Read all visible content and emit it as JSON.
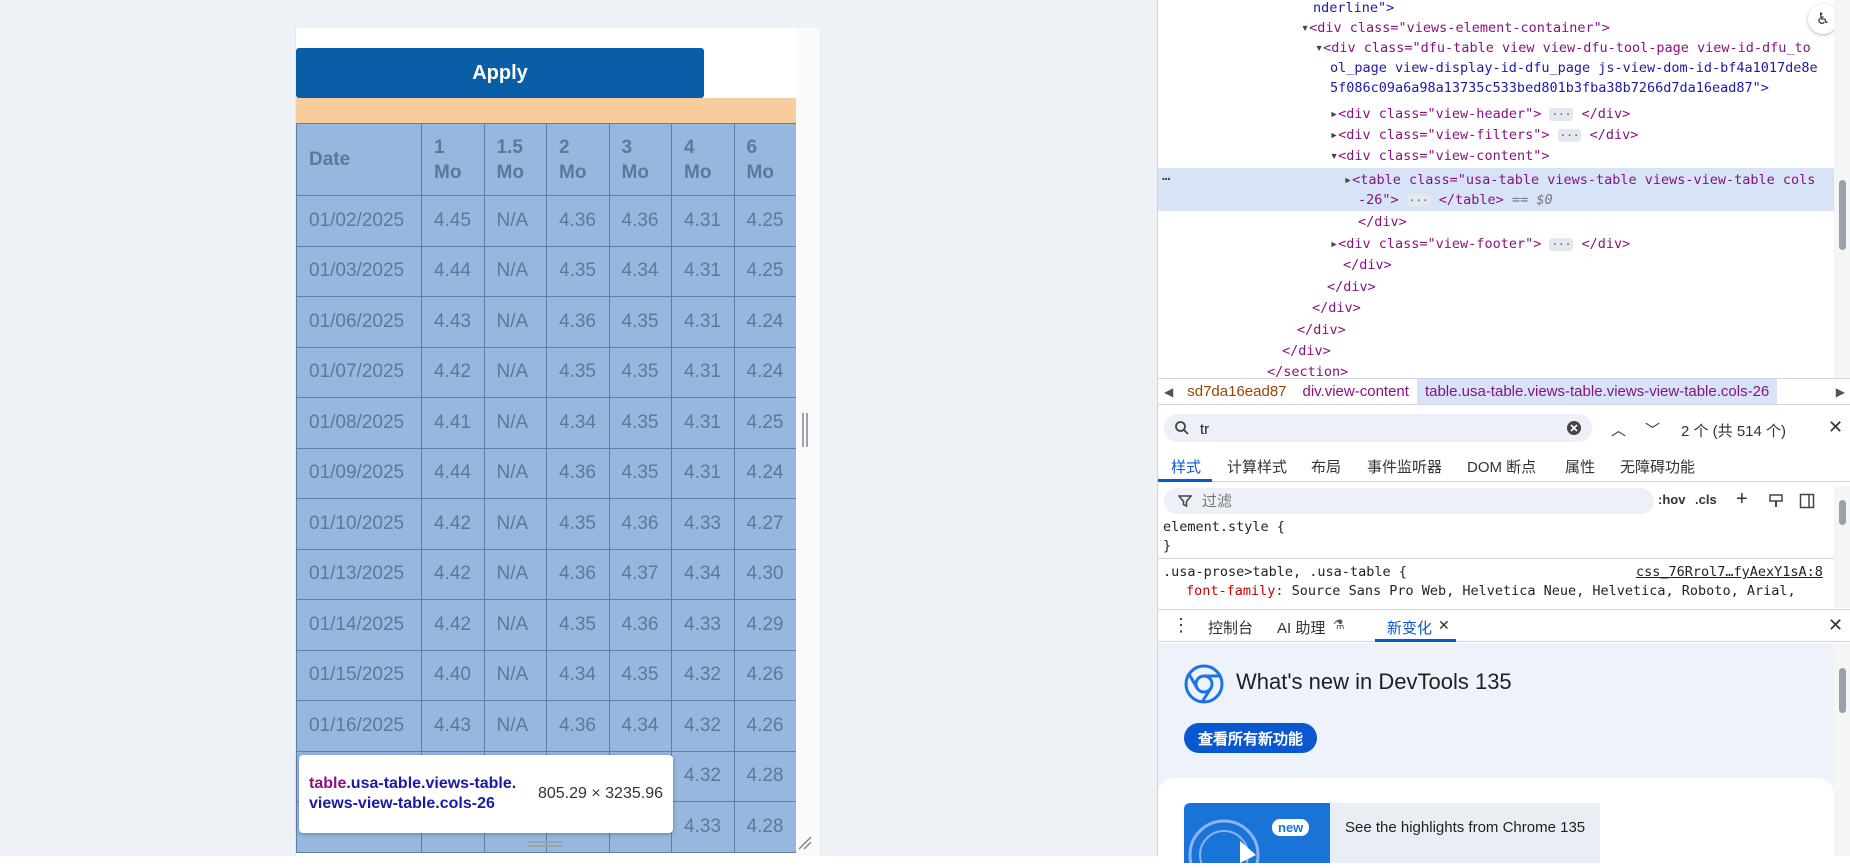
{
  "left_page": {
    "apply_label": "Apply",
    "table": {
      "headers": [
        "Date",
        "1 Mo",
        "1.5 Mo",
        "2 Mo",
        "3 Mo",
        "4 Mo",
        "6 Mo"
      ],
      "rows": [
        [
          "01/02/2025",
          "4.45",
          "N/A",
          "4.36",
          "4.36",
          "4.31",
          "4.25"
        ],
        [
          "01/03/2025",
          "4.44",
          "N/A",
          "4.35",
          "4.34",
          "4.31",
          "4.25"
        ],
        [
          "01/06/2025",
          "4.43",
          "N/A",
          "4.36",
          "4.35",
          "4.31",
          "4.24"
        ],
        [
          "01/07/2025",
          "4.42",
          "N/A",
          "4.35",
          "4.35",
          "4.31",
          "4.24"
        ],
        [
          "01/08/2025",
          "4.41",
          "N/A",
          "4.34",
          "4.35",
          "4.31",
          "4.25"
        ],
        [
          "01/09/2025",
          "4.44",
          "N/A",
          "4.36",
          "4.35",
          "4.31",
          "4.24"
        ],
        [
          "01/10/2025",
          "4.42",
          "N/A",
          "4.35",
          "4.36",
          "4.33",
          "4.27"
        ],
        [
          "01/13/2025",
          "4.42",
          "N/A",
          "4.36",
          "4.37",
          "4.34",
          "4.30"
        ],
        [
          "01/14/2025",
          "4.42",
          "N/A",
          "4.35",
          "4.36",
          "4.33",
          "4.29"
        ],
        [
          "01/15/2025",
          "4.40",
          "N/A",
          "4.34",
          "4.35",
          "4.32",
          "4.26"
        ],
        [
          "01/16/2025",
          "4.43",
          "N/A",
          "4.36",
          "4.34",
          "4.32",
          "4.26"
        ],
        [
          "",
          "",
          "",
          "",
          "",
          "4.32",
          "4.28"
        ],
        [
          "",
          "",
          "",
          "",
          "",
          "4.33",
          "4.28"
        ]
      ]
    },
    "tooltip": {
      "tag": "table",
      "classes": ".usa-table.views-table.views-view-table.cols-26",
      "size": "805.29 × 3235.96"
    }
  },
  "devtools": {
    "dom_lines": [
      "nderline\">",
      "<div class=\"views-element-container\">",
      "<div class=\"dfu-table view view-dfu-tool-page view-id-dfu_to",
      "ol_page view-display-id-dfu_page js-view-dom-id-bf4a1017de8e",
      "5f086c09a6a98a13735c533bed801b3fba38b7266d7da16ead87\">",
      "<div class=\"view-header\">",
      "<div class=\"view-filters\">",
      "<div class=\"view-content\">",
      "<table class=\"usa-table views-table views-view-table cols",
      "-26\">",
      "</div>",
      "<div class=\"view-footer\">",
      "</div>",
      "</div>",
      "</div>",
      "</div>",
      "</div>",
      "</section>"
    ],
    "dom_selected_suffix": "== $0",
    "breadcrumbs": [
      "sd7da16ead87",
      "div.view-content",
      "table.usa-table.views-table.views-view-table.cols-26"
    ],
    "search": {
      "value": "tr",
      "match_info": "2 个 (共 514 个)"
    },
    "style_tabs": [
      "样式",
      "计算样式",
      "布局",
      "事件监听器",
      "DOM 断点",
      "属性",
      "无障碍功能"
    ],
    "filter_placeholder": "过滤",
    "filter_tools": [
      ":hov",
      ".cls"
    ],
    "styles": {
      "element_style": "element.style {",
      "close_brace": "}",
      "rule_selector": ".usa-prose>table, .usa-table {",
      "rule_source": "css_76Rrol7…fyAexY1sA:8",
      "prop_name": "font-family",
      "prop_value": "Source Sans Pro Web, Helvetica Neue, Helvetica, Roboto, Arial,"
    },
    "drawer_tabs": [
      "控制台",
      "AI 助理",
      "新变化"
    ],
    "whats_new": {
      "title": "What's new in DevTools 135",
      "button": "查看所有新功能",
      "badge": "new",
      "highlight": "See the highlights from Chrome 135"
    }
  },
  "colors": {
    "apply": "#0a5ea8",
    "table_fill": "#96b8de",
    "strip": "#f8cd9e",
    "accent": "#0b57d0"
  }
}
